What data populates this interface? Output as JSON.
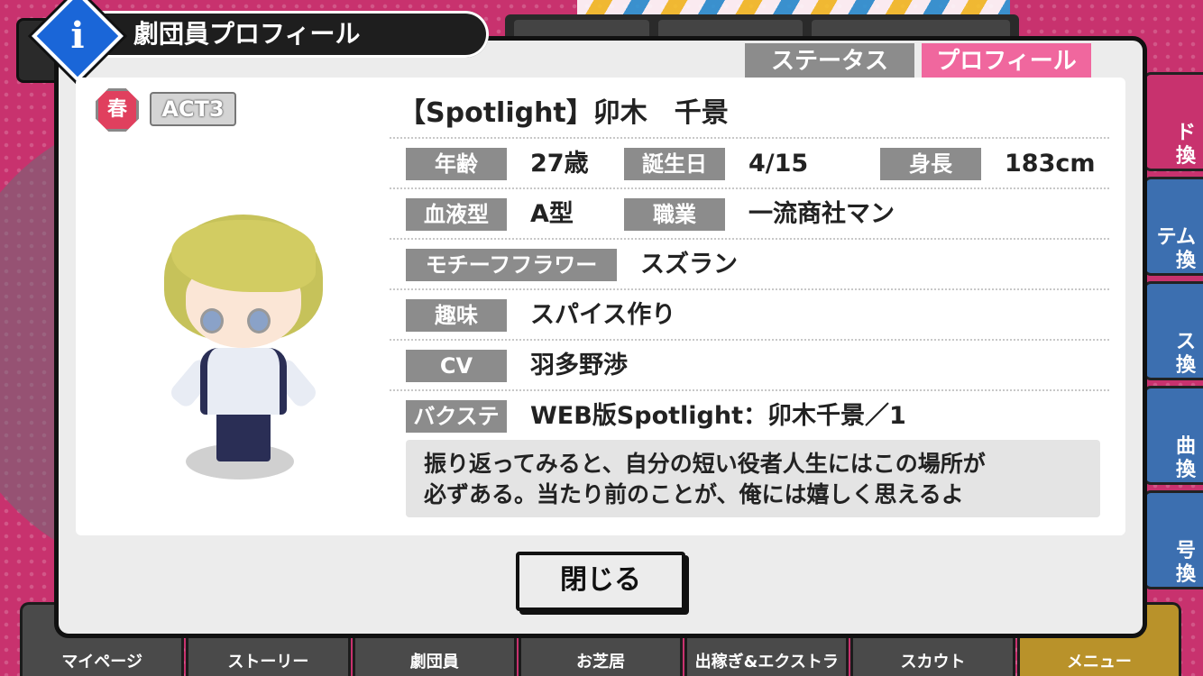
{
  "dialog": {
    "title": "劇団員プロフィール",
    "info_icon_letter": "i",
    "tabs": {
      "status": "ステータス",
      "profile": "プロフィール"
    },
    "badges": {
      "troupe": "春",
      "act": "ACT3"
    },
    "name": "【Spotlight】卯木　千景",
    "profile": {
      "age_label": "年齢",
      "age": "27歳",
      "birthday_label": "誕生日",
      "birthday": "4/15",
      "height_label": "身長",
      "height": "183cm",
      "blood_label": "血液型",
      "blood": "A型",
      "job_label": "職業",
      "job": "一流商社マン",
      "flower_label": "モチーフフラワー",
      "flower": "スズラン",
      "hobby_label": "趣味",
      "hobby": "スパイス作り",
      "cv_label": "CV",
      "cv": "羽多野渉",
      "backstage_label": "バクステ",
      "backstage": "WEB版Spotlight：卯木千景／1"
    },
    "quote_line1": "振り返ってみると、自分の短い役者人生にはこの場所が",
    "quote_line2": "必ずある。当たり前のことが、俺には嬉しく思えるよ",
    "close_label": "閉じる"
  },
  "side_menu": [
    "ド\n換",
    "テム\n換",
    "ス\n換",
    "曲\n換",
    "号\n換"
  ],
  "bottom_nav": [
    "マイページ",
    "ストーリー",
    "劇団員",
    "お芝居",
    "出稼ぎ&エクストラ",
    "スカウト",
    "メニュー"
  ],
  "colors": {
    "accent_pink": "#f0679e",
    "info_blue": "#1a66d8",
    "label_gray": "#8c8c8c",
    "background_magenta": "#c8326e"
  }
}
